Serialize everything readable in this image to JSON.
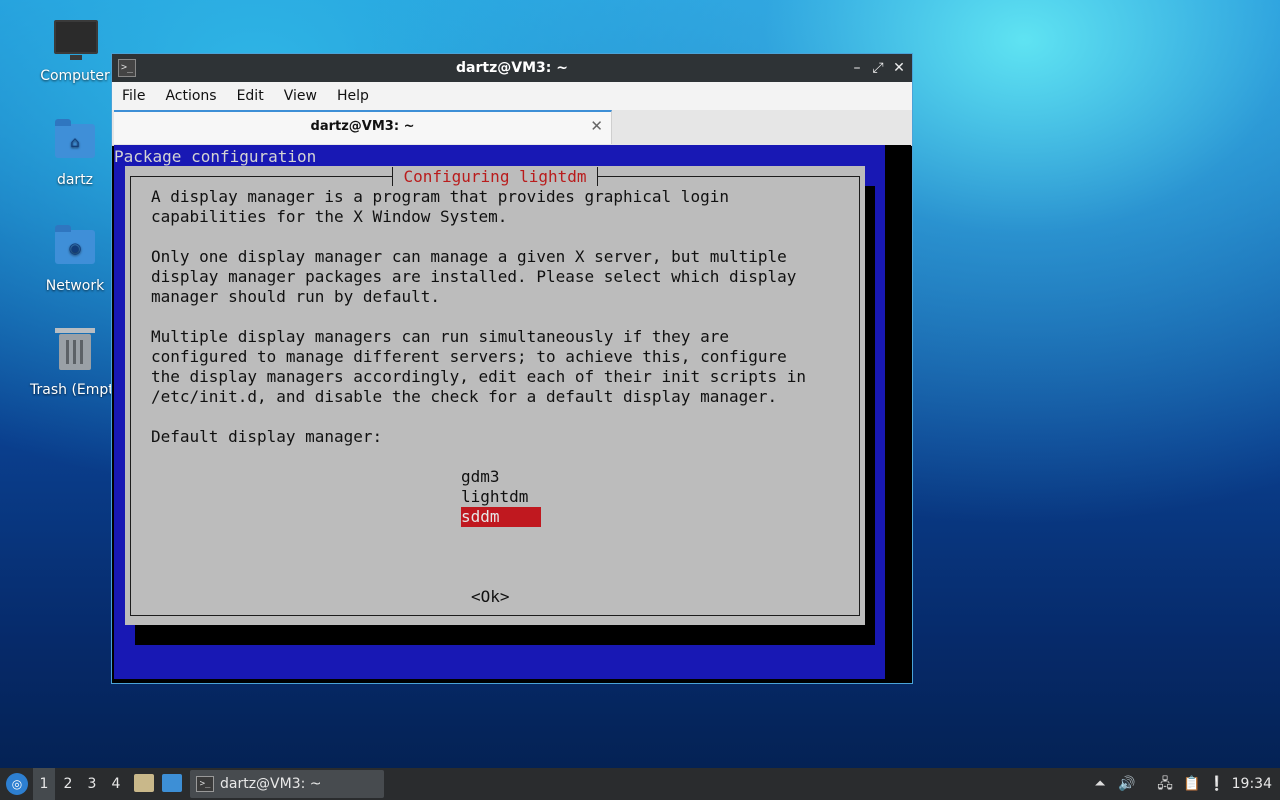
{
  "desktop": {
    "icons": [
      {
        "label": "Computer",
        "icon": "computer-icon"
      },
      {
        "label": "dartz",
        "icon": "home-folder-icon"
      },
      {
        "label": "Network",
        "icon": "network-folder-icon"
      },
      {
        "label": "Trash (Empt",
        "icon": "trash-icon"
      }
    ]
  },
  "window": {
    "title": "dartz@VM3: ~",
    "menu": [
      "File",
      "Actions",
      "Edit",
      "View",
      "Help"
    ],
    "tab_label": "dartz@VM3: ~"
  },
  "terminal": {
    "header": "Package configuration",
    "dialog_title": "Configuring lightdm",
    "paragraphs": [
      "A display manager is a program that provides graphical login\ncapabilities for the X Window System.",
      "Only one display manager can manage a given X server, but multiple\ndisplay manager packages are installed. Please select which display\nmanager should run by default.",
      "Multiple display managers can run simultaneously if they are\nconfigured to manage different servers; to achieve this, configure\nthe display managers accordingly, edit each of their init scripts in\n/etc/init.d, and disable the check for a default display manager.",
      "Default display manager:"
    ],
    "options": [
      "gdm3",
      "lightdm",
      "sddm"
    ],
    "selected_option": "sddm",
    "ok_label": "<Ok>"
  },
  "taskbar": {
    "workspaces": [
      "1",
      "2",
      "3",
      "4"
    ],
    "active_workspace": "1",
    "task_label": "dartz@VM3: ~",
    "clock": "19:34"
  },
  "colors": {
    "dialog_bg": "#bcbcbc",
    "terminal_blue": "#1818b4",
    "selection_red": "#c0181f",
    "title_red": "#b91c1c"
  }
}
